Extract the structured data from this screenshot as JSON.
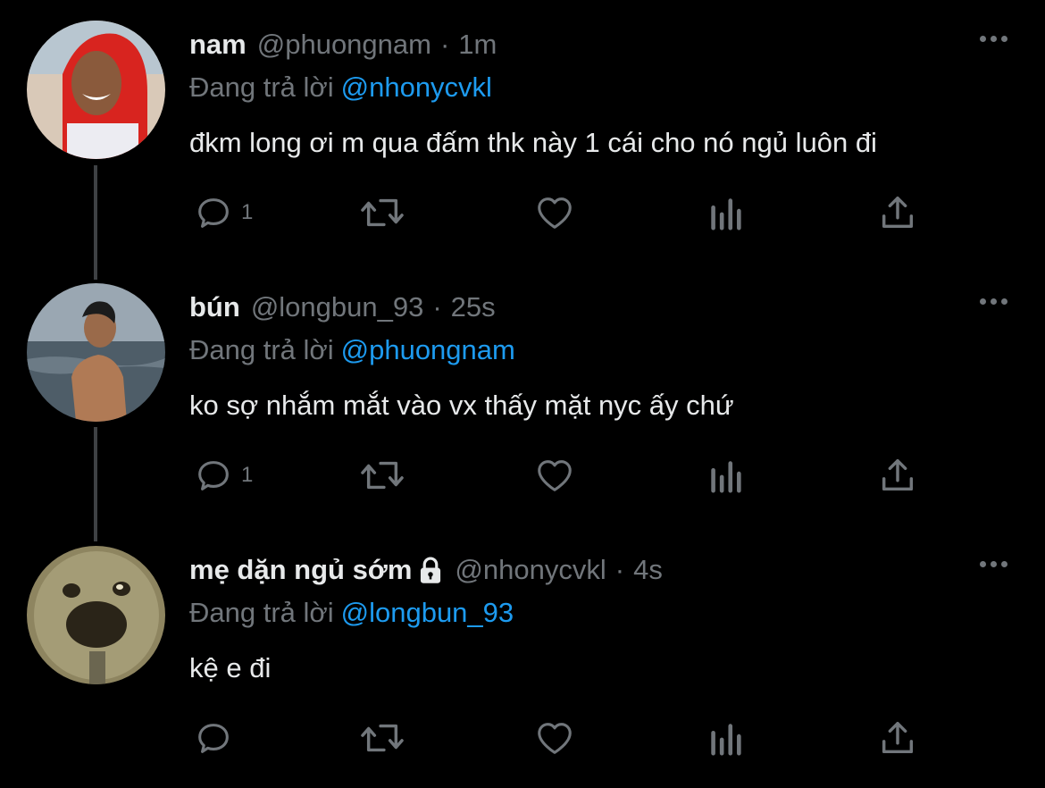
{
  "tweets": [
    {
      "name": "nam",
      "handle": "@phuongnam",
      "separator": "·",
      "time": "1m",
      "replying_prefix": "Đang trả lời",
      "replying_to": "@nhonycvkl",
      "text": "đkm long ơi m qua đấm thk này 1 cái cho nó ngủ luôn đi",
      "reply_count": "1",
      "locked": false
    },
    {
      "name": "bún",
      "handle": "@longbun_93",
      "separator": "·",
      "time": "25s",
      "replying_prefix": "Đang trả lời",
      "replying_to": "@phuongnam",
      "text": "ko sợ nhắm mắt vào vx thấy mặt nyc ấy chứ",
      "reply_count": "1",
      "locked": false
    },
    {
      "name": "mẹ dặn ngủ sớm",
      "handle": "@nhonycvkl",
      "separator": "·",
      "time": "4s",
      "replying_prefix": "Đang trả lời",
      "replying_to": "@longbun_93",
      "text": "kệ e đi",
      "reply_count": "",
      "locked": true
    }
  ],
  "icons": {
    "reply": "reply-icon",
    "retweet": "retweet-icon",
    "like": "heart-icon",
    "analytics": "analytics-icon",
    "share": "share-icon",
    "more": "more-icon",
    "lock": "lock-icon"
  },
  "colors": {
    "background": "#000000",
    "text": "#e7e9ea",
    "secondary": "#71767b",
    "accent": "#1d9bf0",
    "thread_line": "#3e4144"
  }
}
